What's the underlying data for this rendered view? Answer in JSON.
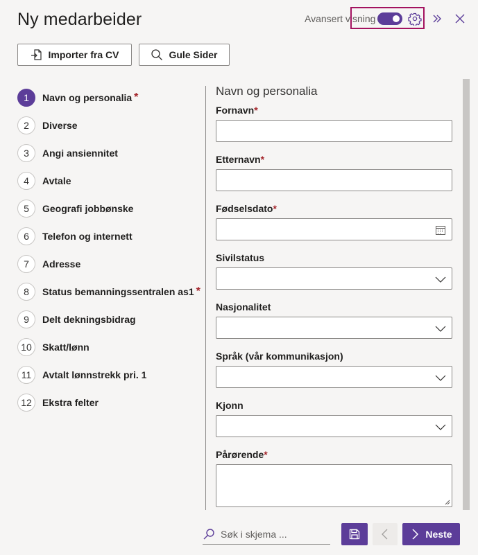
{
  "header": {
    "title": "Ny medarbeider",
    "advanced_label": "Avansert visning",
    "advanced_on": true
  },
  "actions": {
    "import_cv": "Importer fra CV",
    "gule_sider": "Gule Sider"
  },
  "steps": [
    {
      "num": "1",
      "label": "Navn og personalia",
      "required": true,
      "active": true
    },
    {
      "num": "2",
      "label": "Diverse",
      "required": false
    },
    {
      "num": "3",
      "label": "Angi ansiennitet",
      "required": false
    },
    {
      "num": "4",
      "label": "Avtale",
      "required": false
    },
    {
      "num": "5",
      "label": "Geografi jobbønske",
      "required": false
    },
    {
      "num": "6",
      "label": "Telefon og internett",
      "required": false
    },
    {
      "num": "7",
      "label": "Adresse",
      "required": false
    },
    {
      "num": "8",
      "label": "Status bemanningssentralen as1",
      "required": true
    },
    {
      "num": "9",
      "label": "Delt dekningsbidrag",
      "required": false
    },
    {
      "num": "10",
      "label": "Skatt/lønn",
      "required": false
    },
    {
      "num": "11",
      "label": "Avtalt lønnstrekk pri. 1",
      "required": false
    },
    {
      "num": "12",
      "label": "Ekstra felter",
      "required": false
    }
  ],
  "form": {
    "section_title": "Navn og personalia",
    "fields": {
      "fornavn": {
        "label": "Fornavn",
        "required": true,
        "value": ""
      },
      "etternavn": {
        "label": "Etternavn",
        "required": true,
        "value": ""
      },
      "fodselsdato": {
        "label": "Fødselsdato",
        "required": true,
        "value": ""
      },
      "sivilstatus": {
        "label": "Sivilstatus",
        "value": ""
      },
      "nasjonalitet": {
        "label": "Nasjonalitet",
        "value": ""
      },
      "sprak": {
        "label": "Språk (vår kommunikasjon)",
        "value": ""
      },
      "kjonn": {
        "label": "Kjonn",
        "value": ""
      },
      "parorende": {
        "label": "Pårørende",
        "required": true,
        "value": ""
      }
    }
  },
  "footer": {
    "search_placeholder": "Søk i skjema ...",
    "next_label": "Neste"
  },
  "colors": {
    "accent": "#5c3d99",
    "highlight": "#a3125f",
    "required": "#a4262c"
  },
  "required_mark": "*"
}
